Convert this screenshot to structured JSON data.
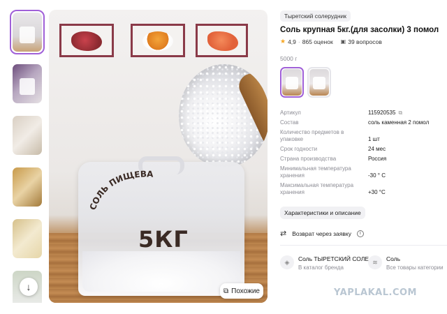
{
  "gallery": {
    "similar_label": "Похожие",
    "bag_print": "СОЛЬ ПИЩЕВАЯ",
    "bag_weight": "5КГ"
  },
  "product": {
    "brand": "Тыретский солерудник",
    "title": "Соль крупная 5кг.(для засолки) 3 помол",
    "rating": "4,9",
    "reviews": "865 оценок",
    "questions": "39 вопросов",
    "weight_label": "5000 г"
  },
  "specs": [
    {
      "key": "Артикул",
      "value": "115920535"
    },
    {
      "key": "Состав",
      "value": "соль каменная 2 помол"
    },
    {
      "key": "Количество предметов в упаковке",
      "value": "1 шт"
    },
    {
      "key": "Срок годности",
      "value": "24 мес"
    },
    {
      "key": "Страна производства",
      "value": "Россия"
    },
    {
      "key": "Минимальная температура хранения",
      "value": "-30 ° C"
    },
    {
      "key": "Максимальная температура хранения",
      "value": "+30 °C"
    }
  ],
  "specs_button": "Характеристики и описание",
  "return": {
    "label": "Возврат через заявку"
  },
  "links": {
    "brand_title": "Соль ТЫРЕТСКИЙ СОЛЕ",
    "brand_sub": "В каталог бренда",
    "category_title": "Соль",
    "category_sub": "Все товары категории"
  },
  "watermark": "YAPLAKAL.COM",
  "colors": {
    "accent": "#a060d8",
    "star": "#f6a623",
    "muted": "#8c8c94"
  }
}
